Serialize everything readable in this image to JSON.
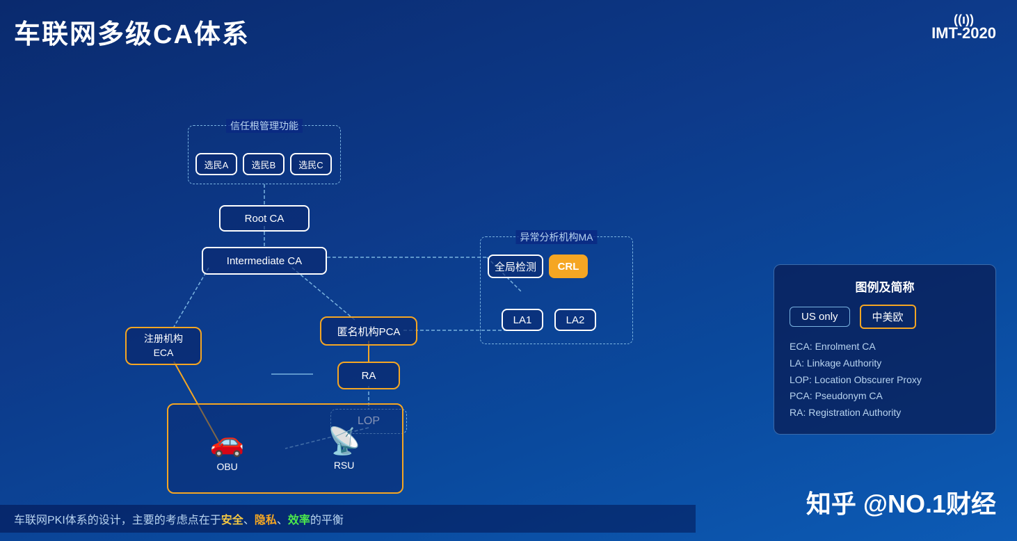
{
  "page": {
    "title": "车联网多级CA体系",
    "logo_text": "IMT-2020",
    "logo_wifi": "((ı))"
  },
  "diagram": {
    "trust_root_label": "信任根管理功能",
    "electors": [
      "选民A",
      "选民B",
      "选民C"
    ],
    "root_ca": "Root CA",
    "intermediate_ca": "Intermediate CA",
    "anomaly_label": "异常分析机构MA",
    "global_detect": "全局检测",
    "crl": "CRL",
    "la1": "LA1",
    "la2": "LA2",
    "pca": "匿名机构PCA",
    "eca_label": "注册机构\nECA",
    "ra": "RA",
    "lop": "LOP",
    "obu": "OBU",
    "rsu": "RSU"
  },
  "legend": {
    "title": "图例及简称",
    "us_only": "US only",
    "cn_us_eu": "中美欧",
    "descriptions": [
      "ECA: Enrolment CA",
      "LA: Linkage Authority",
      "LOP: Location Obscurer Proxy",
      "PCA: Pseudonym CA",
      "RA: Registration Authority"
    ]
  },
  "tagline": {
    "prefix": "车联网PKI体系的设计，主要的考虑点在于",
    "highlight1": "安全",
    "sep1": "、",
    "highlight2": "隐私",
    "sep2": "、",
    "highlight3": "效率",
    "suffix": "的平衡"
  },
  "brand": "知乎 @NO.1财经"
}
